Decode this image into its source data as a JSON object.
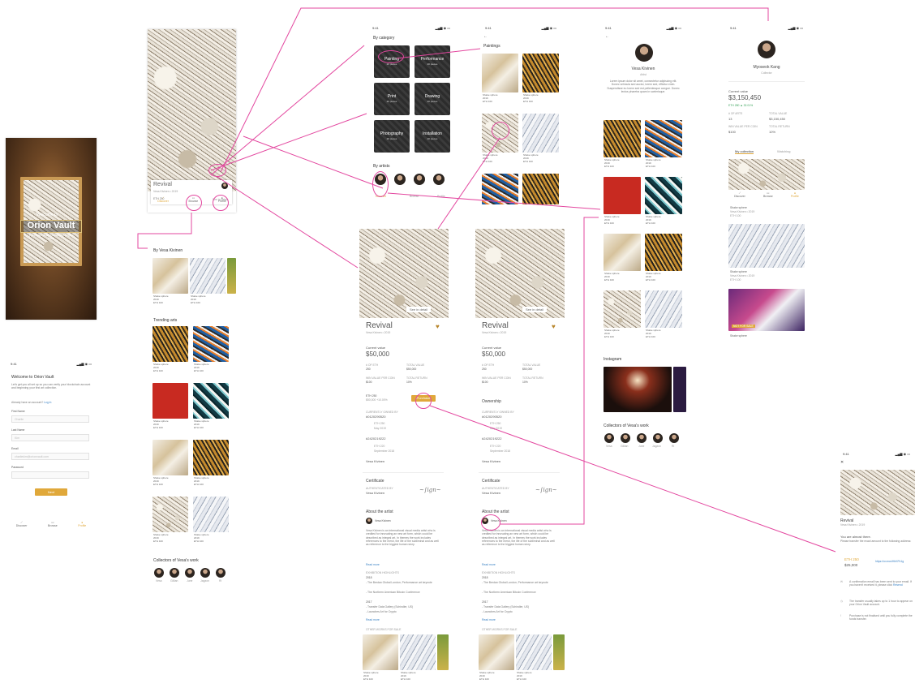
{
  "statusbar": {
    "time": "9:41",
    "signal": "▂▄▆ ◉ ▭"
  },
  "welcome": {
    "line1": "Welcome to",
    "brand": "Orion Vault",
    "tagline": "The future of art investment begins here"
  },
  "signup": {
    "title": "Welcome to Orion Vault",
    "intro": "Let's get you all set up so you can verify your blockchain account and beginning your first art collection.",
    "have_account": "Already have an account?",
    "login_link": "Log in",
    "fields": [
      {
        "label": "First Name",
        "placeholder": "Charlie"
      },
      {
        "label": "Last Name",
        "placeholder": "Kim"
      },
      {
        "label": "Email",
        "placeholder": "charliekim@orionvault.com"
      },
      {
        "label": "Password",
        "placeholder": ""
      }
    ],
    "next_label": "Next"
  },
  "nav": {
    "discover": "Discover",
    "browse": "Browse",
    "profile": "Profile"
  },
  "artwork": {
    "title": "Revival",
    "subtitle": "Vesa Kivinen • 2019",
    "price": "ETH 250",
    "see_detail": "See in detail"
  },
  "discover": {
    "section_artist": "By Vesa Kivinen",
    "section_trending": "Trending arts",
    "section_collectors": "Collectors of Vesa's work",
    "card_title": "Shake sphere",
    "card_year": "2019",
    "card_price": "ETH 100",
    "collectors": [
      "Vesa",
      "Gillian",
      "June",
      "Jagzon",
      "Ri"
    ]
  },
  "browse": {
    "by_category": "By category",
    "categories": [
      {
        "name": "Painting",
        "count": "20 pieces"
      },
      {
        "name": "Performance",
        "count": "20 pieces"
      },
      {
        "name": "Print",
        "count": "20 pieces"
      },
      {
        "name": "Drawing",
        "count": "20 pieces"
      },
      {
        "name": "Photography",
        "count": "20 pieces"
      },
      {
        "name": "Installation",
        "count": "20 pieces"
      }
    ],
    "by_artists": "By artists",
    "artist_labels": [
      "Discover",
      "Browse",
      "Profile"
    ]
  },
  "paintings": {
    "title": "Paintings",
    "back": "←"
  },
  "artist": {
    "name": "Vesa Kivinen",
    "role": "Artist",
    "bio": "Lorem ipsum dolor sit amet, consectetur adipiscing elit. Donec vehicula sed auctor, lorem sed, efficitur enim. Suspendisse eu lorem sed est pellentesque congue. Donec lectus pharetra quam in scelerisque.",
    "instagram": "Instagram",
    "collectors_title": "Collectors of Vesa's work",
    "collectors": [
      "Vesa",
      "Gillian",
      "June",
      "Jagzon",
      "Ri"
    ]
  },
  "collector": {
    "name": "Myoseok Kang",
    "role": "Collector",
    "current_value_label": "Current value",
    "current_value": "$3,150,450",
    "change": "ETH 280 ▲ 32.01%",
    "stats": [
      {
        "label": "# OF ARTS",
        "value": "13"
      },
      {
        "label": "TOTAL VALUE",
        "value": "$3,150,450"
      },
      {
        "label": "WIN VALUE PER COIN",
        "value": "$100"
      },
      {
        "label": "TOTAL RETURN",
        "value": "10%"
      }
    ],
    "tabs": [
      "My collection",
      "Watching"
    ],
    "items": [
      {
        "title": "Shake sphere",
        "sub": "Vesa Kivinen • 2019",
        "price": "ETH 100"
      },
      {
        "title": "Shake sphere",
        "sub": "Vesa Kivinen • 2019",
        "price": "ETH 100"
      },
      {
        "title": "Shake sphere",
        "sub": "",
        "price": ""
      }
    ],
    "badge": "NOT FOR SALE"
  },
  "detail": {
    "current_value_label": "Current value",
    "current_value": "$50,000",
    "stats": [
      {
        "label": "# OF ETH",
        "value": "250"
      },
      {
        "label": "TOTAL VALUE",
        "value": "$50,000"
      },
      {
        "label": "WIN VALUE PER COIN",
        "value": "$100"
      },
      {
        "label": "TOTAL RETURN",
        "value": "10%"
      }
    ],
    "eth": "ETH 250",
    "eth_sub": "$50,000 +10.00%",
    "purchase": "Purchase",
    "ownership": "Ownership",
    "currently_owned_by": "CURRENTLY OWNED BY",
    "owner_hash1": "#0120290520",
    "owner_eth1": "ETH 250",
    "owner_date1": "May 2019",
    "owner_hash2": "#2420219222",
    "owner_eth2": "ETH 220",
    "owner_date2": "September 2018",
    "owner_name": "Vesa Kivinen",
    "certificate": "Certificate",
    "authenticated_by": "AUTHENTICATED BY",
    "auth_name": "Vesa Kivinen",
    "about": "About the artist",
    "about_text": "Vesa Kivinen is an international visual media artist who is credited for innovating an new art form, which could be described as integral art. In themes the work includes references to the mesh, the life of the subliminal and as well as reference to the biggest human story.",
    "read_more": "Read more",
    "exhibition_highlights": "EXHIBITION HIGHLIGHTS",
    "y2018": "2018",
    "ex2018": "- The Bredan Global London, Performance art keynote",
    "ex2018b": "- The Northern American Bitcoin Conference",
    "y2017": "2017",
    "ex2017": "- Transfer Data Gallery (Schindler, US)",
    "ex2017b": "- Launches Art for Crypto",
    "other_works": "OTHER WORKS FOR SALE"
  },
  "transfer": {
    "close": "✕",
    "title": "Revival",
    "sub": "Vesa Kivinen • 2019",
    "almost": "You are almost there.",
    "instructions": "Please transfer the exact amount to the following address:",
    "eth": "ETH 250",
    "usd": "$25,000",
    "address": "https://ov.eos/HhKFh1g",
    "note1": "A confirmation email has been sent to your email. If you haven't received it, please click",
    "note1_link": "Resend",
    "note2": "The transfer usually takes up to 1 hour to appear on your Orion Vault account.",
    "note3": "Purchase is not finalised until you fully complete the funds transfer."
  },
  "colors": {
    "accent": "#e0a83a",
    "wire": "#e3479f",
    "text": "#444444"
  }
}
